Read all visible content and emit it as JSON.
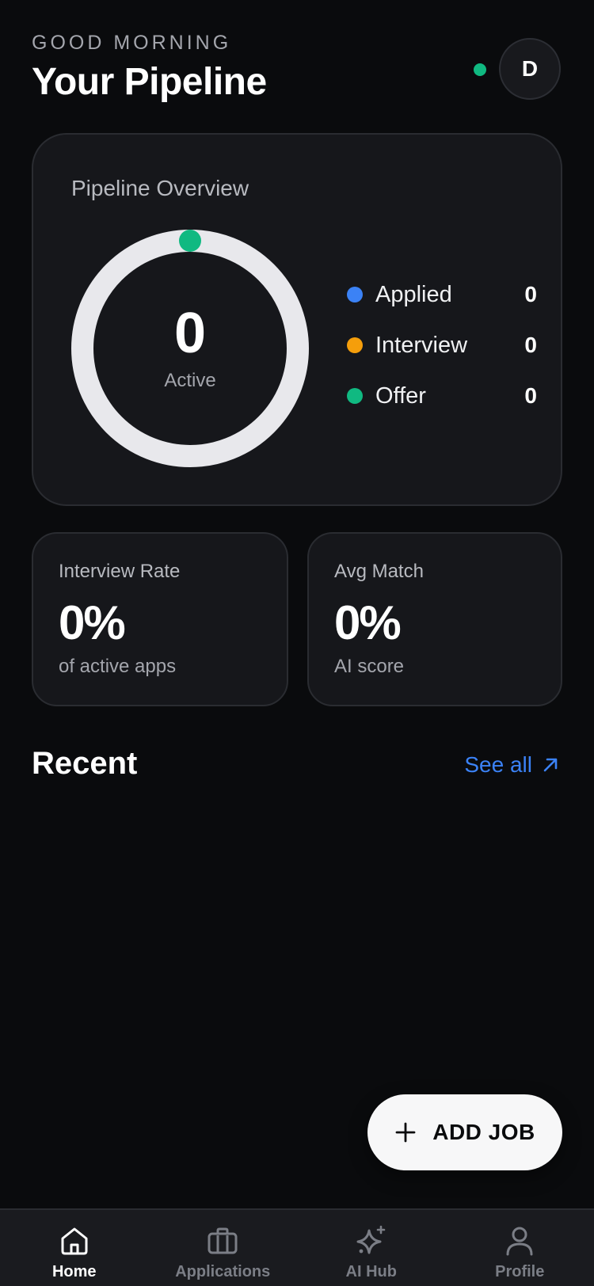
{
  "header": {
    "greeting": "GOOD MORNING",
    "title": "Your Pipeline",
    "avatar_initial": "D",
    "online_color": "#10b981"
  },
  "overview": {
    "title": "Pipeline Overview",
    "active_count": "0",
    "active_label": "Active",
    "legend": [
      {
        "label": "Applied",
        "count": "0",
        "color": "#3b82f6"
      },
      {
        "label": "Interview",
        "count": "0",
        "color": "#f59e0b"
      },
      {
        "label": "Offer",
        "count": "0",
        "color": "#10b981"
      }
    ]
  },
  "stats": [
    {
      "label": "Interview Rate",
      "value": "0%",
      "sub": "of active apps"
    },
    {
      "label": "Avg Match",
      "value": "0%",
      "sub": "AI score"
    }
  ],
  "recent": {
    "title": "Recent",
    "see_all_label": "See all"
  },
  "fab": {
    "label": "ADD JOB"
  },
  "nav": {
    "items": [
      {
        "label": "Home",
        "icon": "home-icon",
        "active": true
      },
      {
        "label": "Applications",
        "icon": "briefcase-icon",
        "active": false
      },
      {
        "label": "AI Hub",
        "icon": "sparkles-icon",
        "active": false
      },
      {
        "label": "Profile",
        "icon": "user-icon",
        "active": false
      }
    ]
  },
  "colors": {
    "accent": "#3b82f6",
    "background": "#0a0b0d",
    "card": "#16171b"
  }
}
